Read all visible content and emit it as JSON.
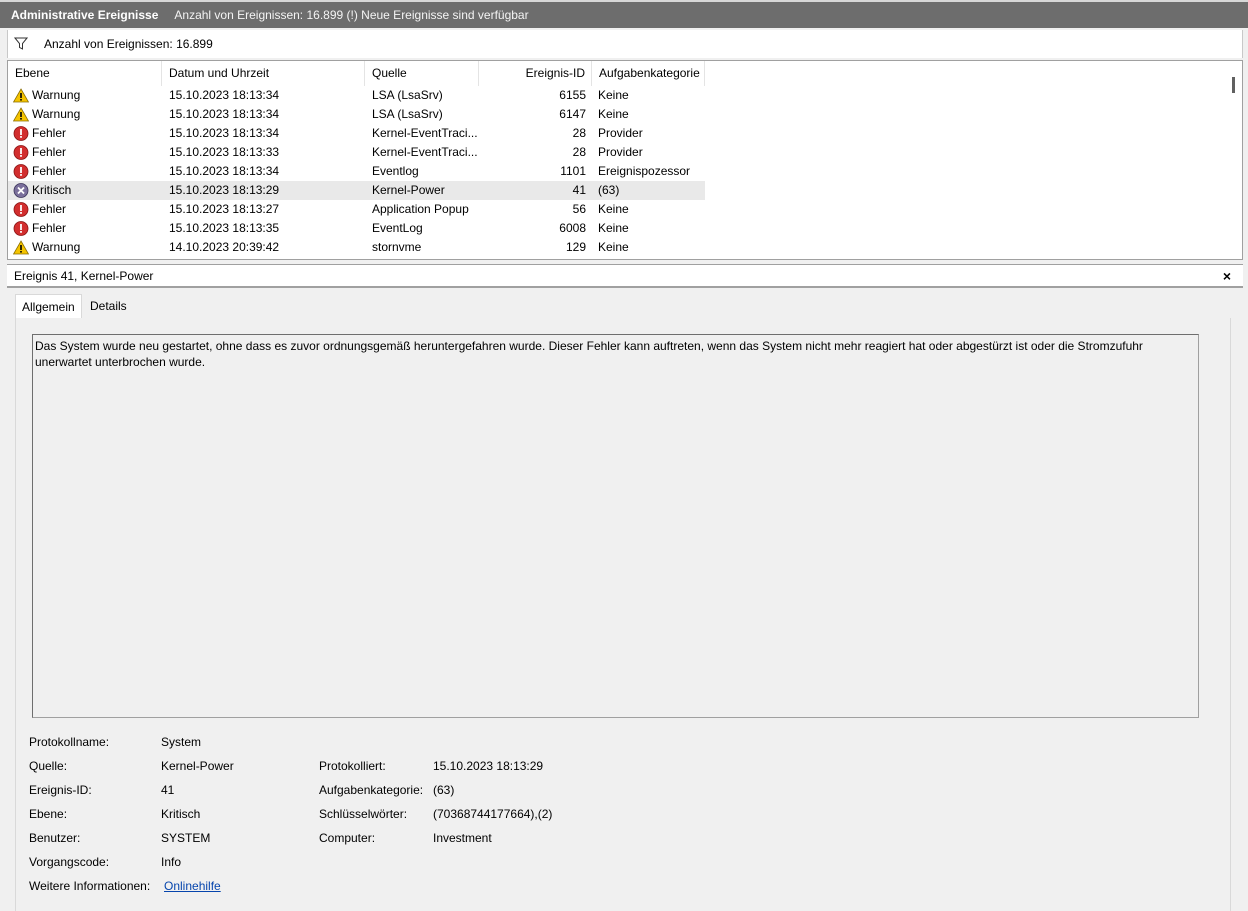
{
  "titlebar": {
    "title": "Administrative Ereignisse",
    "info": "Anzahl von Ereignissen: 16.899 (!) Neue Ereignisse sind verfügbar"
  },
  "filterbar": {
    "icon": "filter-icon",
    "text": "Anzahl von Ereignissen: 16.899"
  },
  "columns": [
    "Ebene",
    "Datum und Uhrzeit",
    "Quelle",
    "Ereignis-ID",
    "Aufgabenkategorie"
  ],
  "events": [
    {
      "level": "Warnung",
      "icon": "warning-icon",
      "date": "15.10.2023 18:13:34",
      "source": "LSA (LsaSrv)",
      "id": "6155",
      "category": "Keine"
    },
    {
      "level": "Warnung",
      "icon": "warning-icon",
      "date": "15.10.2023 18:13:34",
      "source": "LSA (LsaSrv)",
      "id": "6147",
      "category": "Keine"
    },
    {
      "level": "Fehler",
      "icon": "error-icon",
      "date": "15.10.2023 18:13:34",
      "source": "Kernel-EventTraci...",
      "id": "28",
      "category": "Provider"
    },
    {
      "level": "Fehler",
      "icon": "error-icon",
      "date": "15.10.2023 18:13:33",
      "source": "Kernel-EventTraci...",
      "id": "28",
      "category": "Provider"
    },
    {
      "level": "Fehler",
      "icon": "error-icon",
      "date": "15.10.2023 18:13:34",
      "source": "Eventlog",
      "id": "1101",
      "category": "Ereignispozessor"
    },
    {
      "level": "Kritisch",
      "icon": "critical-icon",
      "date": "15.10.2023 18:13:29",
      "source": "Kernel-Power",
      "id": "41",
      "category": "(63)",
      "selected": true
    },
    {
      "level": "Fehler",
      "icon": "error-icon",
      "date": "15.10.2023 18:13:27",
      "source": "Application Popup",
      "id": "56",
      "category": "Keine"
    },
    {
      "level": "Fehler",
      "icon": "error-icon",
      "date": "15.10.2023 18:13:35",
      "source": "EventLog",
      "id": "6008",
      "category": "Keine"
    },
    {
      "level": "Warnung",
      "icon": "warning-icon",
      "date": "14.10.2023 20:39:42",
      "source": "stornvme",
      "id": "129",
      "category": "Keine"
    }
  ],
  "detail": {
    "title": "Ereignis 41, Kernel-Power",
    "close": "×",
    "tabs": [
      "Allgemein",
      "Details"
    ],
    "description": "Das System wurde neu gestartet, ohne dass es zuvor ordnungsgemäß heruntergefahren wurde. Dieser Fehler kann auftreten, wenn das System nicht mehr reagiert hat oder abgestürzt ist oder die Stromzufuhr unerwartet unterbrochen wurde.",
    "props": {
      "protokollname_label": "Protokollname:",
      "protokollname": "System",
      "quelle_label": "Quelle:",
      "quelle": "Kernel-Power",
      "ereignisid_label": "Ereignis-ID:",
      "ereignisid": "41",
      "ebene_label": "Ebene:",
      "ebene": "Kritisch",
      "benutzer_label": "Benutzer:",
      "benutzer": "SYSTEM",
      "vorgangscode_label": "Vorgangscode:",
      "vorgangscode": "Info",
      "weitere_label": "Weitere Informationen:",
      "weitere_link": "Onlinehilfe",
      "protokolliert_label": "Protokolliert:",
      "protokolliert": "15.10.2023 18:13:29",
      "aufgabe_label": "Aufgabenkategorie:",
      "aufgabe": "(63)",
      "schluessel_label": "Schlüsselwörter:",
      "schluessel": "(70368744177664),(2)",
      "computer_label": "Computer:",
      "computer": "Investment"
    }
  },
  "colors": {
    "titlebar": "#6d6d6d",
    "warning": "#f5c400",
    "error": "#d22e2e",
    "critical": "#7a6f9b",
    "link": "#0645ad"
  }
}
